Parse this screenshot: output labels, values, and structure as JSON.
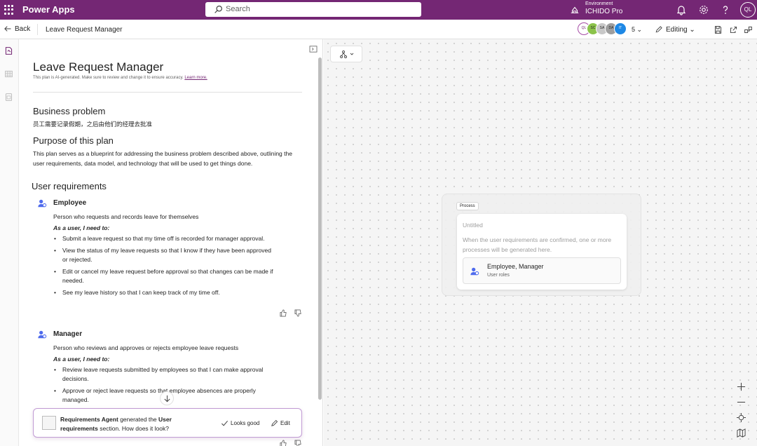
{
  "topbar": {
    "app_name": "Power Apps",
    "search_placeholder": "Search",
    "environment_label": "Environment",
    "environment_name": "ICHIDO Pro",
    "user_initials": "QL"
  },
  "cmdbar": {
    "back_label": "Back",
    "title": "Leave Request Manager",
    "collaborators": [
      "QL",
      "SC",
      "SA",
      "DA",
      "IT"
    ],
    "collaborator_count": "5",
    "mode_label": "Editing"
  },
  "doc": {
    "title": "Leave Request Manager",
    "ai_note": "This plan is AI-generated. Make sure to review and change it to ensure accuracy.",
    "learn_more": "Learn more.",
    "business_problem_heading": "Business problem",
    "business_problem_text": "员工需要记录假期，之后由他们的经理去批准",
    "purpose_heading": "Purpose of this plan",
    "purpose_text": "This plan serves as a blueprint for addressing the business problem described above, outlining the user requirements, data model, and technology that will be used to get things done.",
    "user_requirements_heading": "User requirements",
    "need_label": "As a user, I need to:",
    "roles": [
      {
        "name": "Employee",
        "description": "Person who requests and records leave for themselves",
        "needs": [
          "Submit a leave request so that my time off is recorded for manager approval.",
          "View the status of my leave requests so that I know if they have been approved or rejected.",
          "Edit or cancel my leave request before approval so that changes can be made if needed.",
          "See my leave history so that I can keep track of my time off."
        ]
      },
      {
        "name": "Manager",
        "description": "Person who reviews and approves or rejects employee leave requests",
        "needs": [
          "Review leave requests submitted by employees so that I can make approval decisions.",
          "Approve or reject leave requests so that employee absences are properly managed."
        ]
      }
    ]
  },
  "toast": {
    "agent_name": "Requirements Agent",
    "middle_text": "generated the",
    "section_name": "User requirements",
    "tail_text": "section. How does it look?",
    "looks_good_label": "Looks good",
    "edit_label": "Edit"
  },
  "canvas": {
    "process_tag": "Process",
    "process_title": "Untitled",
    "process_desc": "When the user requirements are confirmed, one or more processes will be generated here.",
    "roles_name": "Employee, Manager",
    "roles_sub": "User roles"
  },
  "colors": {
    "brand": "#742774",
    "role_icon": "#4f6bed"
  }
}
